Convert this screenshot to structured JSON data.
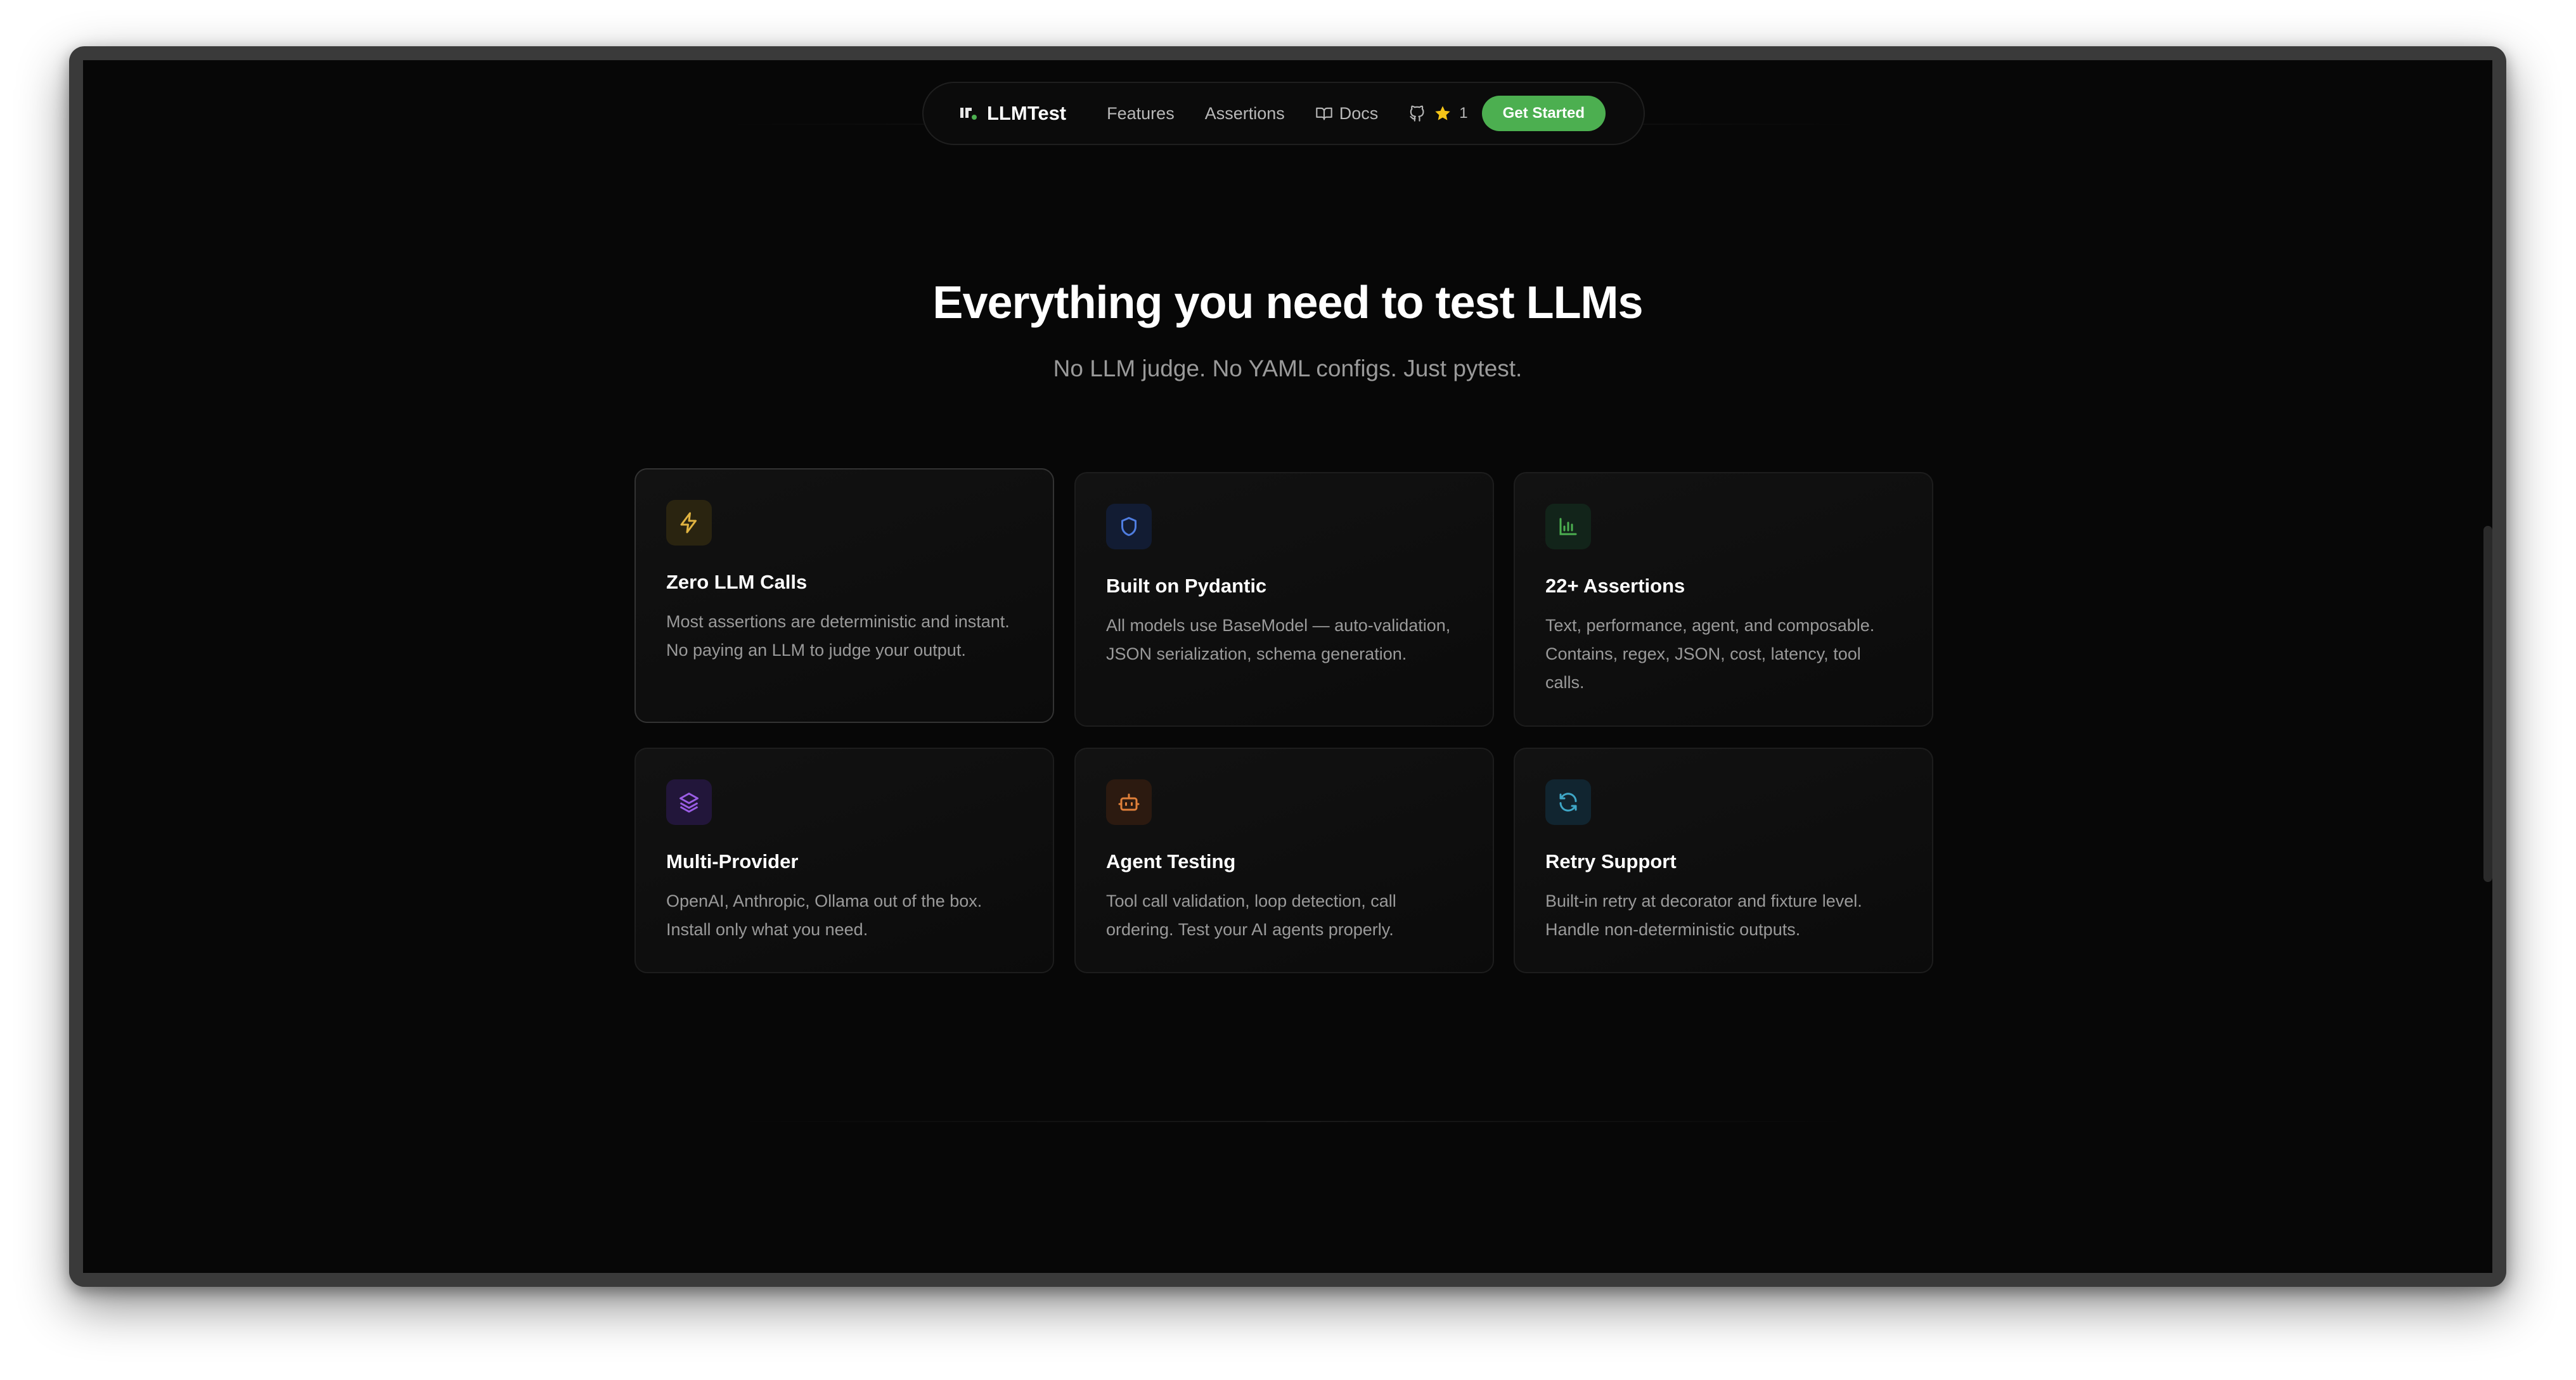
{
  "nav": {
    "brand": "LLMTest",
    "links": [
      "Features",
      "Assertions",
      "Docs"
    ],
    "stars": "1",
    "cta": "Get Started"
  },
  "hero": {
    "title": "Everything you need to test LLMs",
    "subtitle": "No LLM judge. No YAML configs. Just pytest."
  },
  "features": [
    {
      "title": "Zero LLM Calls",
      "icon": "lightning-icon",
      "color": "#e0b341",
      "desc": "Most assertions are deterministic and instant. No paying an LLM to judge your output."
    },
    {
      "title": "Built on Pydantic",
      "icon": "shield-icon",
      "color": "#4f7de0",
      "desc": "All models use BaseModel — auto-validation, JSON serialization, schema generation."
    },
    {
      "title": "22+ Assertions",
      "icon": "bar-chart-icon",
      "color": "#4caf50",
      "desc": "Text, performance, agent, and composable. Contains, regex, JSON, cost, latency, tool calls."
    },
    {
      "title": "Multi-Provider",
      "icon": "layers-icon",
      "color": "#9b5de5",
      "desc": "OpenAI, Anthropic, Ollama out of the box. Install only what you need."
    },
    {
      "title": "Agent Testing",
      "icon": "bot-icon",
      "color": "#e0803a",
      "desc": "Tool call validation, loop detection, call ordering. Test your AI agents properly."
    },
    {
      "title": "Retry Support",
      "icon": "refresh-icon",
      "color": "#3fa7c7",
      "desc": "Built-in retry at decorator and fixture level. Handle non-deterministic outputs."
    }
  ]
}
